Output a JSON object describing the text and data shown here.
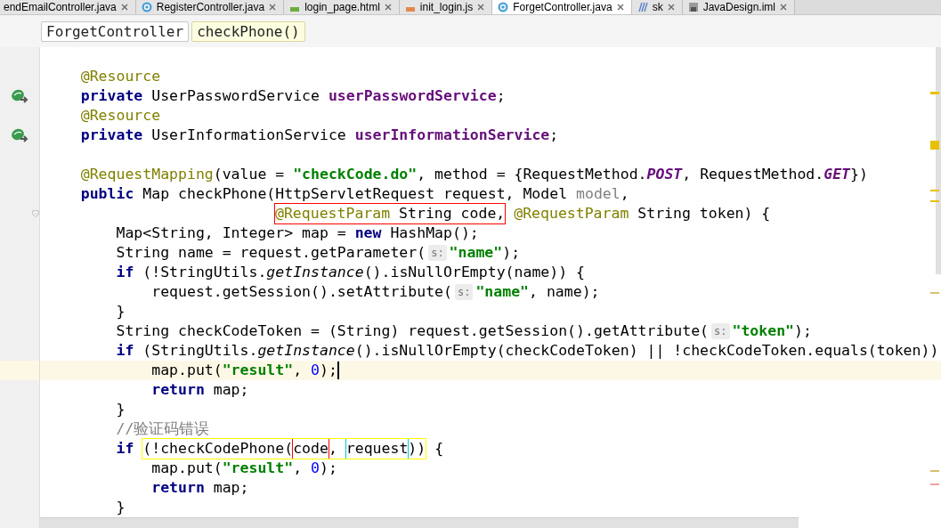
{
  "tabs": [
    {
      "label": "endEmailController.java",
      "kind": "none",
      "selected": false
    },
    {
      "label": "RegisterController.java",
      "kind": "class",
      "selected": false
    },
    {
      "label": "login_page.html",
      "kind": "html",
      "selected": false
    },
    {
      "label": "init_login.js",
      "kind": "js",
      "selected": false
    },
    {
      "label": "ForgetController.java",
      "kind": "class",
      "selected": true
    },
    {
      "label": "sk",
      "kind": "folder",
      "selected": false
    },
    {
      "label": "JavaDesign.iml",
      "kind": "iml",
      "selected": false
    }
  ],
  "breadcrumb": [
    {
      "label": "ForgetController",
      "selected": false
    },
    {
      "label": "checkPhone()",
      "selected": true
    }
  ],
  "lines": [
    {
      "current": false
    },
    {
      "current": false,
      "tokens": [
        {
          "kind": "a",
          "text": "    @Resource"
        }
      ]
    },
    {
      "current": false,
      "kind": "bean",
      "tokens": [
        {
          "kind": "k",
          "text": "    private"
        },
        {
          "kind": "p",
          "text": " UserPasswordService "
        },
        {
          "kind": "f",
          "text": "userPasswordService"
        },
        {
          "kind": "p",
          "text": ";"
        }
      ]
    },
    {
      "current": false,
      "tokens": [
        {
          "kind": "a",
          "text": "    @Resource"
        }
      ]
    },
    {
      "current": false,
      "kind": "bean",
      "tokens": [
        {
          "kind": "k",
          "text": "    private"
        },
        {
          "kind": "p",
          "text": " UserInformationService "
        },
        {
          "kind": "f",
          "text": "userInformationService"
        },
        {
          "kind": "p",
          "text": ";"
        }
      ]
    },
    {
      "current": false
    },
    {
      "current": false,
      "tokens": [
        {
          "kind": "a",
          "text": "    @RequestMapping"
        },
        {
          "kind": "p",
          "text": "(value = "
        },
        {
          "kind": "s",
          "text": "\"checkCode.do\""
        },
        {
          "kind": "p",
          "text": ", method = {RequestMethod."
        },
        {
          "kind": "c",
          "text": "POST"
        },
        {
          "kind": "p",
          "text": ", RequestMethod."
        },
        {
          "kind": "c",
          "text": "GET"
        },
        {
          "kind": "p",
          "text": "})"
        }
      ]
    },
    {
      "current": false,
      "tokens": [
        {
          "kind": "k",
          "text": "    public"
        },
        {
          "kind": "p",
          "text": " Map checkPhone(HttpServletRequest request, Model "
        },
        {
          "kind": "g",
          "text": "model"
        },
        {
          "kind": "p",
          "text": ","
        }
      ]
    },
    {
      "current": false,
      "kind": "fold",
      "tokens": [
        {
          "kind": "box",
          "color": "#ff0000",
          "children": [
            {
              "kind": "a",
              "text": "@RequestParam"
            },
            {
              "kind": "p",
              "text": " String code,"
            }
          ]
        },
        {
          "kind": "a",
          "text": " @RequestParam"
        },
        {
          "kind": "p",
          "text": " String token) {"
        }
      ]
    },
    {
      "current": false,
      "tokens": [
        {
          "kind": "p",
          "text": "        Map<String, Integer> map = "
        },
        {
          "kind": "k",
          "text": "new"
        },
        {
          "kind": "p",
          "text": " HashMap();"
        }
      ]
    },
    {
      "current": false,
      "tokens": [
        {
          "kind": "p",
          "text": "        String name = request.getParameter("
        },
        {
          "kind": "hint",
          "text": "s:"
        },
        {
          "kind": "s",
          "text": "\"name\""
        },
        {
          "kind": "p",
          "text": ");"
        }
      ]
    },
    {
      "current": false,
      "tokens": [
        {
          "kind": "k",
          "text": "        if"
        },
        {
          "kind": "p",
          "text": " (!StringUtils."
        },
        {
          "kind": "i",
          "text": "getInstance"
        },
        {
          "kind": "p",
          "text": "().isNullOrEmpty(name)) {"
        }
      ]
    },
    {
      "current": false,
      "tokens": [
        {
          "kind": "p",
          "text": "            request.getSession().setAttribute("
        },
        {
          "kind": "hint",
          "text": "s:"
        },
        {
          "kind": "s",
          "text": "\"name\""
        },
        {
          "kind": "p",
          "text": ", name);"
        }
      ]
    },
    {
      "current": false,
      "tokens": [
        {
          "kind": "p",
          "text": "        }"
        }
      ]
    },
    {
      "current": false,
      "tokens": [
        {
          "kind": "p",
          "text": "        String checkCodeToken = (String) request.getSession().getAttribute("
        },
        {
          "kind": "hint",
          "text": "s:"
        },
        {
          "kind": "s",
          "text": "\"token\""
        },
        {
          "kind": "p",
          "text": ");"
        }
      ]
    },
    {
      "current": false,
      "tokens": [
        {
          "kind": "k",
          "text": "        if"
        },
        {
          "kind": "p",
          "text": " (StringUtils."
        },
        {
          "kind": "i",
          "text": "getInstance"
        },
        {
          "kind": "p",
          "text": "().isNullOrEmpty(checkCodeToken) || !checkCodeToken.equals(token))"
        }
      ]
    },
    {
      "current": true,
      "tokens": [
        {
          "kind": "p",
          "text": "            map.put("
        },
        {
          "kind": "s",
          "text": "\"result\""
        },
        {
          "kind": "p",
          "text": ", "
        },
        {
          "kind": "n",
          "text": "0"
        },
        {
          "kind": "p",
          "text": ");"
        }
      ]
    },
    {
      "current": false,
      "tokens": [
        {
          "kind": "k",
          "text": "            return"
        },
        {
          "kind": "p",
          "text": " map;"
        }
      ]
    },
    {
      "current": false,
      "tokens": [
        {
          "kind": "p",
          "text": "        }"
        }
      ]
    },
    {
      "current": false,
      "tokens": [
        {
          "kind": "m",
          "text": "        //验证码错误"
        }
      ]
    },
    {
      "current": false,
      "tokens": [
        {
          "kind": "k",
          "text": "        if "
        },
        {
          "kind": "box",
          "color": "#ffff00",
          "children": [
            {
              "kind": "p",
              "text": "(!checkCodePhone("
            },
            {
              "kind": "box",
              "color": "#ff0000",
              "children": [
                {
                  "kind": "p",
                  "text": "code"
                }
              ]
            },
            {
              "kind": "p",
              "text": ", "
            },
            {
              "kind": "box",
              "color": "#00cccc",
              "children": [
                {
                  "kind": "p",
                  "text": "request"
                }
              ]
            },
            {
              "kind": "p",
              "text": "))"
            }
          ]
        },
        {
          "kind": "p",
          "text": " {"
        }
      ]
    },
    {
      "current": false,
      "tokens": [
        {
          "kind": "p",
          "text": "            map.put("
        },
        {
          "kind": "s",
          "text": "\"result\""
        },
        {
          "kind": "p",
          "text": ", "
        },
        {
          "kind": "n",
          "text": "0"
        },
        {
          "kind": "p",
          "text": ");"
        }
      ]
    },
    {
      "current": false,
      "tokens": [
        {
          "kind": "k",
          "text": "            return"
        },
        {
          "kind": "p",
          "text": " map;"
        }
      ]
    },
    {
      "current": false,
      "tokens": [
        {
          "kind": "p",
          "text": "        }"
        }
      ]
    }
  ]
}
